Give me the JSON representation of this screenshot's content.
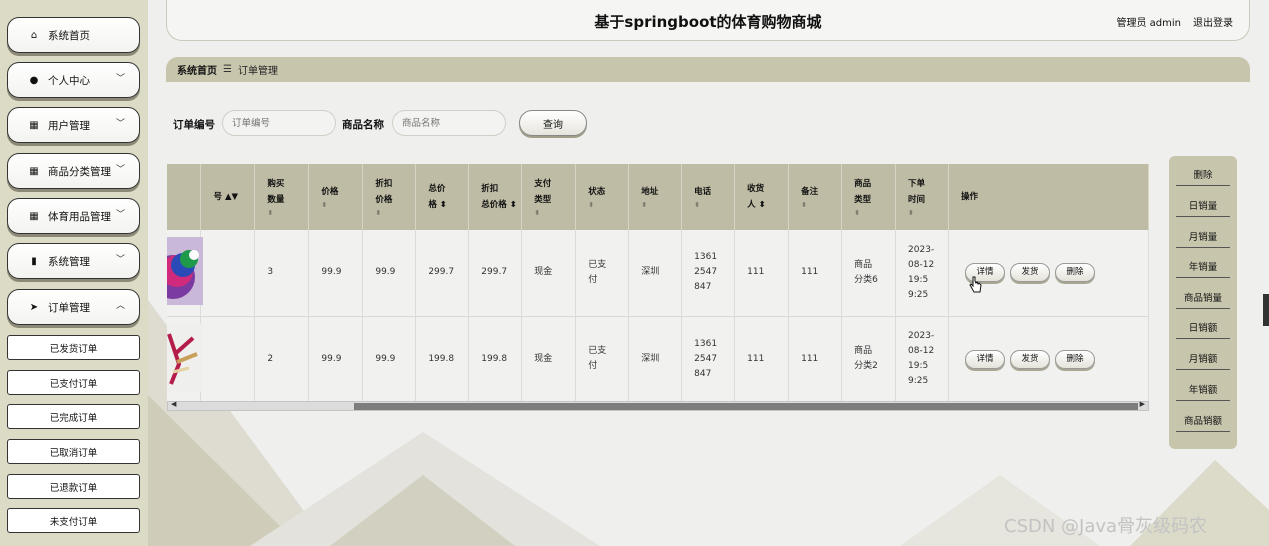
{
  "header": {
    "title": "基于springboot的体育购物商城",
    "admin_label": "管理员 admin",
    "logout_label": "退出登录"
  },
  "sidebar": {
    "items": [
      {
        "label": "系统首页",
        "icon": "home-icon",
        "chevron": ""
      },
      {
        "label": "个人中心",
        "icon": "user-icon",
        "chevron": "﹀"
      },
      {
        "label": "用户管理",
        "icon": "grid-icon",
        "chevron": "﹀"
      },
      {
        "label": "商品分类管理",
        "icon": "grid-icon",
        "chevron": "﹀"
      },
      {
        "label": "体育用品管理",
        "icon": "grid-icon",
        "chevron": "﹀"
      },
      {
        "label": "系统管理",
        "icon": "chart-icon",
        "chevron": "﹀"
      },
      {
        "label": "订单管理",
        "icon": "send-icon",
        "chevron": "︿"
      }
    ],
    "subitems": [
      "已发货订单",
      "已支付订单",
      "已完成订单",
      "已取消订单",
      "已退款订单",
      "未支付订单"
    ]
  },
  "breadcrumb": {
    "home": "系统首页",
    "separator": "☰",
    "current": "订单管理"
  },
  "search": {
    "order_no_label": "订单编号",
    "order_no_placeholder": "订单编号",
    "product_name_label": "商品名称",
    "product_name_placeholder": "商品名称",
    "query_button": "查询"
  },
  "table": {
    "columns": [
      {
        "l1": "号",
        "l2": "",
        "sort": true
      },
      {
        "l1": "购买",
        "l2": "数量",
        "sort": true
      },
      {
        "l1": "价格",
        "l2": "",
        "sort": true
      },
      {
        "l1": "折扣",
        "l2": "价格",
        "sort": true
      },
      {
        "l1": "总价",
        "l2": "格",
        "sort": true
      },
      {
        "l1": "折扣",
        "l2": "总价格",
        "sort": true
      },
      {
        "l1": "支付",
        "l2": "类型",
        "sort": true
      },
      {
        "l1": "状态",
        "l2": "",
        "sort": true
      },
      {
        "l1": "地址",
        "l2": "",
        "sort": true
      },
      {
        "l1": "电话",
        "l2": "",
        "sort": true
      },
      {
        "l1": "收货",
        "l2": "人",
        "sort": true
      },
      {
        "l1": "备注",
        "l2": "",
        "sort": true
      },
      {
        "l1": "商品",
        "l2": "类型",
        "sort": true
      },
      {
        "l1": "下单",
        "l2": "时间",
        "sort": true
      },
      {
        "l1": "操作",
        "l2": "",
        "sort": false
      }
    ],
    "rows": [
      {
        "quantity": "3",
        "price": "99.9",
        "discount_price": "99.9",
        "total": "299.7",
        "discount_total": "299.7",
        "pay_type": "现金",
        "status": "已支付",
        "address": "深圳",
        "phone": "13612547847",
        "receiver": "111",
        "remark": "111",
        "category": "商品分类6",
        "order_time": "2023-08-12 19:59:25"
      },
      {
        "quantity": "2",
        "price": "99.9",
        "discount_price": "99.9",
        "total": "199.8",
        "discount_total": "199.8",
        "pay_type": "现金",
        "status": "已支付",
        "address": "深圳",
        "phone": "13612547847",
        "receiver": "111",
        "remark": "111",
        "category": "商品分类2",
        "order_time": "2023-08-12 19:59:25"
      }
    ],
    "actions": {
      "detail": "详情",
      "ship": "发货",
      "delete": "删除"
    },
    "sort_icon": "sort-icon"
  },
  "stats_panel": {
    "items": [
      "删除",
      "日销量",
      "月销量",
      "年销量",
      "商品销量",
      "日销额",
      "月销额",
      "年销额",
      "商品销额"
    ]
  },
  "watermark": "CSDN @Java骨灰级码农",
  "colors": {
    "sidebar_bg": "#dcdbc6",
    "accent_khaki": "#c8c5ad",
    "table_header": "#bfbca5"
  }
}
